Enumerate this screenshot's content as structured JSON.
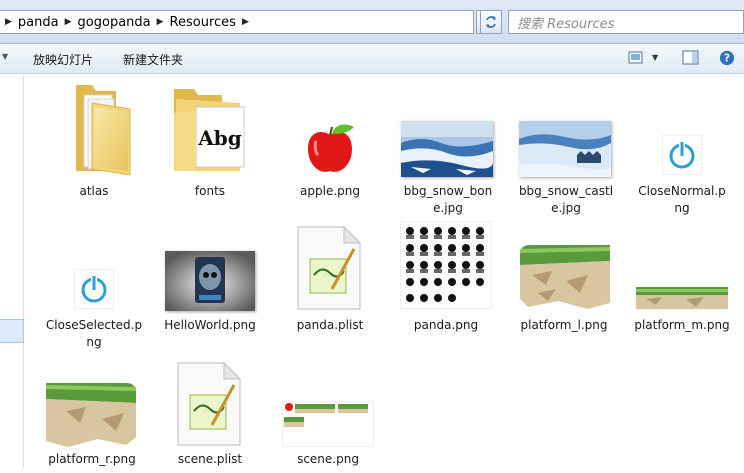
{
  "address_bar": {
    "crumbs": [
      "panda",
      "gogopanda",
      "Resources"
    ],
    "search_placeholder": "搜索 Resources"
  },
  "toolbar": {
    "slideshow": "放映幻灯片",
    "new_folder": "新建文件夹"
  },
  "files": [
    {
      "label": "atlas",
      "type": "folder"
    },
    {
      "label": "fonts",
      "type": "font-folder",
      "thumb_text": "Abg"
    },
    {
      "label": "apple.png",
      "type": "apple"
    },
    {
      "label": "bbg_snow_bon\ne.jpg",
      "type": "snow"
    },
    {
      "label": "bbg_snow_castl\ne.jpg",
      "type": "snow-castle"
    },
    {
      "label": "CloseNormal.p\nng",
      "type": "power"
    },
    {
      "label": "CloseSelected.p\nng",
      "type": "power"
    },
    {
      "label": "HelloWorld.png",
      "type": "helloworld"
    },
    {
      "label": "panda.plist",
      "type": "plist"
    },
    {
      "label": "panda.png",
      "type": "panda-sheet"
    },
    {
      "label": "platform_l.png",
      "type": "platform"
    },
    {
      "label": "platform_m.png",
      "type": "platform-thin"
    },
    {
      "label": "platform_r.png",
      "type": "platform"
    },
    {
      "label": "scene.plist",
      "type": "plist"
    },
    {
      "label": "scene.png",
      "type": "scene"
    }
  ],
  "colors": {
    "folder": "#e9c561",
    "power_blue": "#2b9fd6",
    "grass": "#5a9a3c",
    "rock": "#d8c6a0"
  }
}
